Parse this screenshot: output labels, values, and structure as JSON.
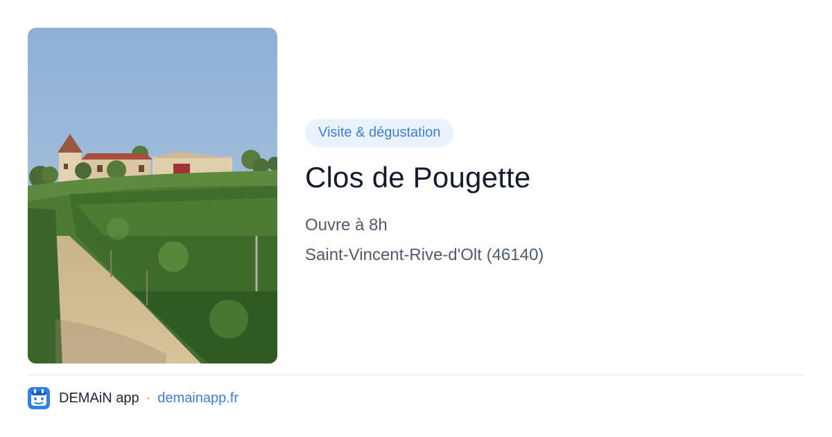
{
  "listing": {
    "category": "Visite & dégustation",
    "name": "Clos de Pougette",
    "hours": "Ouvre à 8h",
    "location": "Saint-Vincent-Rive-d'Olt (46140)",
    "photo_icon": "vineyard-photo"
  },
  "footer": {
    "app_name": "DEMAiN app",
    "separator": "·",
    "site": "demainapp.fr",
    "icon": "demain-app-icon"
  },
  "colors": {
    "accent": "#3c7fd8",
    "badge_bg": "#eaf3fd",
    "title": "#141b2d",
    "body_text": "#4f5b6e"
  }
}
